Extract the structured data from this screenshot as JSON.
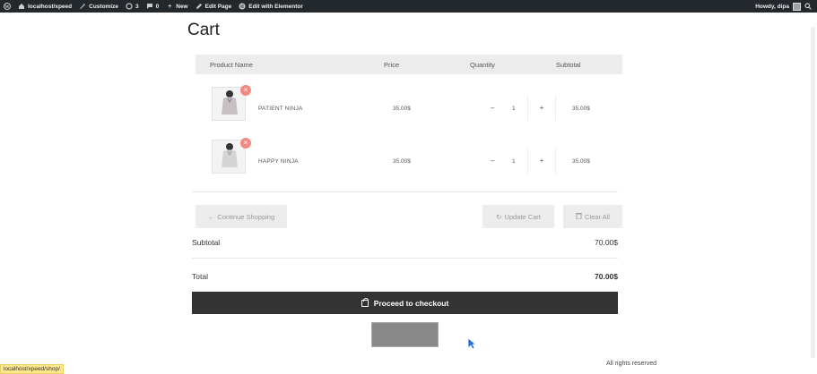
{
  "adminbar": {
    "site": "localhost/xpeed",
    "customize": "Customize",
    "updates": "3",
    "comments": "0",
    "new": "New",
    "edit_page": "Edit Page",
    "elementor": "Edit with Elementor",
    "howdy": "Howdy, dipa"
  },
  "page": {
    "title": "Cart"
  },
  "cart": {
    "headers": {
      "product": "Product Name",
      "price": "Price",
      "quantity": "Quantity",
      "subtotal": "Subtotal"
    },
    "items": [
      {
        "name": "PATIENT NINJA",
        "price": "35.00$",
        "qty": "1",
        "subtotal": "35.00$",
        "minus": "–",
        "plus": "+",
        "remove": "×"
      },
      {
        "name": "HAPPY NINJA",
        "price": "35.00$",
        "qty": "1",
        "subtotal": "35.00$",
        "minus": "–",
        "plus": "+",
        "remove": "×"
      }
    ]
  },
  "actions": {
    "continue": "Continue Shopping",
    "update": "Update Cart",
    "clear": "Clear All"
  },
  "totals": {
    "subtotal_label": "Subtotal",
    "subtotal_value": "70.00$",
    "total_label": "Total",
    "total_value": "70.00$"
  },
  "checkout": {
    "label": "Proceed to checkout"
  },
  "footer": {
    "text": "All rights reserved"
  },
  "statusbar": {
    "url": "localhost/xpeed/shop/"
  }
}
